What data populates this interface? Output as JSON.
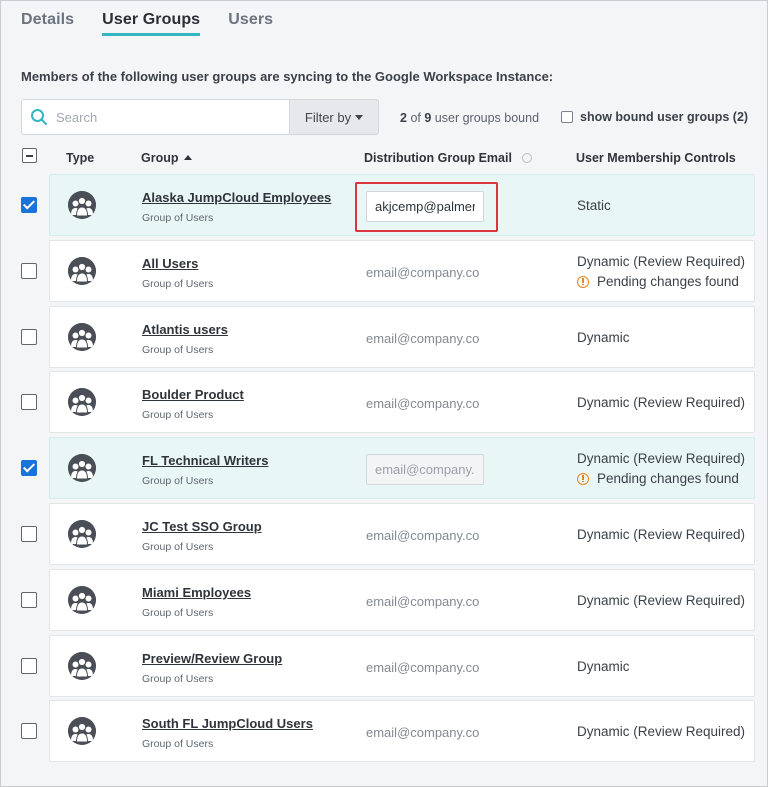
{
  "tabs": [
    {
      "label": "Details",
      "active": false
    },
    {
      "label": "User Groups",
      "active": true
    },
    {
      "label": "Users",
      "active": false
    }
  ],
  "intro": "Members of the following user groups are syncing to the Google Workspace Instance:",
  "search": {
    "placeholder": "Search"
  },
  "filter": {
    "label": "Filter by"
  },
  "bound": {
    "count": "2",
    "of": "of",
    "total": "9",
    "suffix": "user groups bound"
  },
  "show_bound": {
    "label": "show bound user groups (2)"
  },
  "headers": {
    "type": "Type",
    "group": "Group",
    "email": "Distribution Group Email",
    "controls": "User Membership Controls"
  },
  "rows": [
    {
      "name": "Alaska JumpCloud Employees",
      "sub": "Group of Users",
      "checked": true,
      "email": "akjcemp@palmera",
      "email_mode": "input-active",
      "controls": "Static",
      "pending": ""
    },
    {
      "name": "All Users",
      "sub": "Group of Users",
      "checked": false,
      "email": "email@company.co",
      "email_mode": "text",
      "controls": "Dynamic (Review Required)",
      "pending": "Pending changes found"
    },
    {
      "name": "Atlantis users",
      "sub": "Group of Users",
      "checked": false,
      "email": "email@company.co",
      "email_mode": "text",
      "controls": "Dynamic",
      "pending": ""
    },
    {
      "name": "Boulder Product",
      "sub": "Group of Users",
      "checked": false,
      "email": "email@company.co",
      "email_mode": "text",
      "controls": "Dynamic (Review Required)",
      "pending": ""
    },
    {
      "name": "FL Technical Writers",
      "sub": "Group of Users",
      "checked": true,
      "email": "email@company.c",
      "email_mode": "input",
      "controls": "Dynamic (Review Required)",
      "pending": "Pending changes found"
    },
    {
      "name": "JC Test SSO Group",
      "sub": "Group of Users",
      "checked": false,
      "email": "email@company.co",
      "email_mode": "text",
      "controls": "Dynamic (Review Required)",
      "pending": ""
    },
    {
      "name": "Miami Employees",
      "sub": "Group of Users",
      "checked": false,
      "email": "email@company.co",
      "email_mode": "text",
      "controls": "Dynamic (Review Required)",
      "pending": ""
    },
    {
      "name": "Preview/Review Group",
      "sub": "Group of Users",
      "checked": false,
      "email": "email@company.co",
      "email_mode": "text",
      "controls": "Dynamic",
      "pending": ""
    },
    {
      "name": "South FL JumpCloud Users",
      "sub": "Group of Users",
      "checked": false,
      "email": "email@company.co",
      "email_mode": "text",
      "controls": "Dynamic (Review Required)",
      "pending": ""
    }
  ],
  "colors": {
    "accent": "#33b5c3",
    "checkbox": "#1a73d9",
    "warning": "#e8851a",
    "highlight": "#d9363e",
    "selected_row": "#e9f6f6"
  },
  "icons": {
    "group": "group-users-icon",
    "search": "search-icon",
    "info": "info-icon",
    "warning": "warning-icon"
  }
}
